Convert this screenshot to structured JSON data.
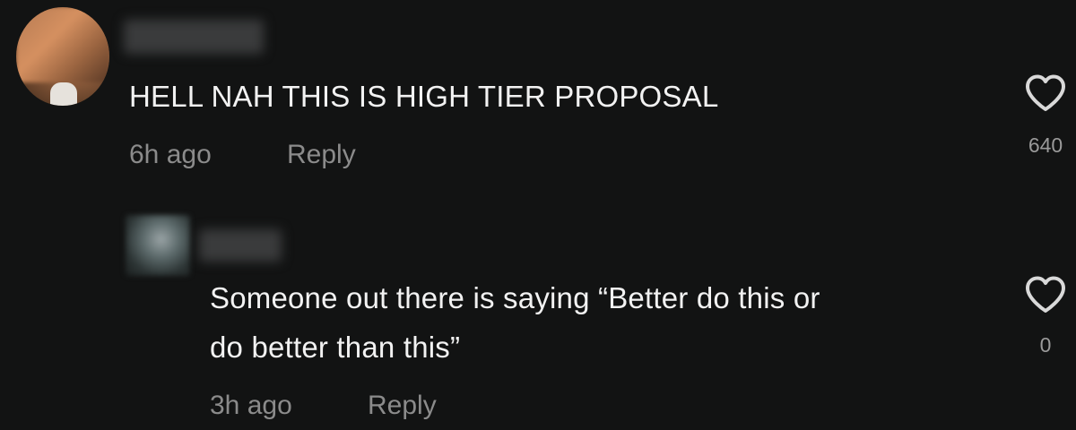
{
  "comments": [
    {
      "text": "HELL NAH THIS IS HIGH TIER PROPOSAL",
      "time": "6h ago",
      "reply_label": "Reply",
      "likes": "640",
      "like_icon": "heart-outline-icon"
    },
    {
      "text_line1": "Someone out there is saying “Better do this or",
      "text_line2": "do better than this”",
      "time": "3h ago",
      "reply_label": "Reply",
      "likes": "0",
      "like_icon": "heart-outline-icon"
    }
  ],
  "colors": {
    "background": "#121313",
    "text": "#f2f2f2",
    "meta": "#8b8b8b",
    "icon": "#d9d9d9"
  }
}
